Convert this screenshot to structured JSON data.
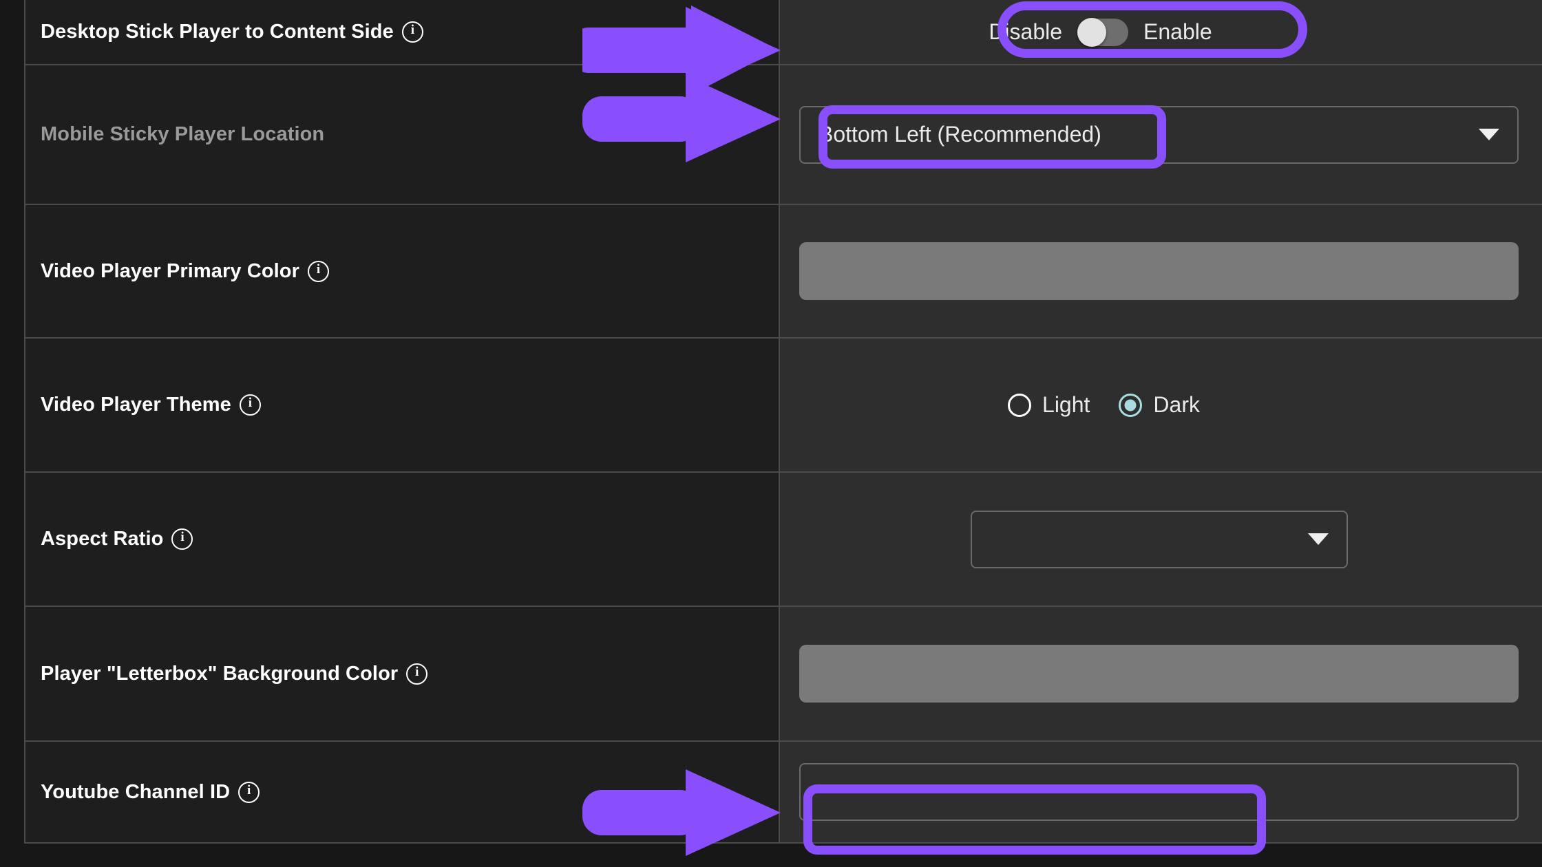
{
  "theme": {
    "page_bg": "#171717",
    "label_cell_bg": "#1e1e1e",
    "control_cell_bg": "#2e2e2e",
    "border": "#4b4b4b",
    "accent_annotation": "#8a4ffc",
    "swatch_gray": "#7a7a7a",
    "radio_checked": "#a8dbe0",
    "toggle_track": "#6e6e6e",
    "toggle_knob": "#e2e2e2"
  },
  "settings": {
    "rows": [
      {
        "id": "desktop-stick-player-to-content-side",
        "label": "Desktop Stick Player to Content Side",
        "label_muted": false,
        "info_icon": "info-circle-icon",
        "control": "toggle",
        "toggle": {
          "off_label": "Disable",
          "on_label": "Enable",
          "state": "off"
        }
      },
      {
        "id": "mobile-sticky-player-location",
        "label": "Mobile Sticky Player Location",
        "label_muted": true,
        "info_icon": null,
        "control": "select-wide",
        "select": {
          "value": "Bottom Left (Recommended)",
          "chevron_icon": "chevron-down-icon"
        }
      },
      {
        "id": "video-player-primary-color",
        "label": "Video Player Primary Color",
        "label_muted": false,
        "info_icon": "info-circle-icon",
        "control": "color-swatch",
        "swatch": {
          "color": "#7a7a7a"
        }
      },
      {
        "id": "video-player-theme",
        "label": "Video Player Theme",
        "label_muted": false,
        "info_icon": "info-circle-icon",
        "control": "radio",
        "radio": {
          "options": [
            {
              "label": "Light",
              "checked": false
            },
            {
              "label": "Dark",
              "checked": true
            }
          ]
        }
      },
      {
        "id": "aspect-ratio",
        "label": "Aspect Ratio",
        "label_muted": false,
        "info_icon": "info-circle-icon",
        "control": "select-mid",
        "select": {
          "value": "",
          "chevron_icon": "chevron-down-icon"
        }
      },
      {
        "id": "player-letterbox-background-color",
        "label": "Player \"Letterbox\" Background Color",
        "label_muted": false,
        "info_icon": "info-circle-icon",
        "control": "color-swatch",
        "swatch": {
          "color": "#7a7a7a"
        }
      },
      {
        "id": "youtube-channel-id",
        "label": "Youtube Channel ID",
        "label_muted": false,
        "info_icon": "info-circle-icon",
        "control": "text-input",
        "input": {
          "value": "",
          "placeholder": ""
        }
      }
    ]
  },
  "annotations": {
    "color": "#8a4ffc",
    "arrows": [
      {
        "target": "desktop-stick-player-to-content-side"
      },
      {
        "target": "mobile-sticky-player-location"
      },
      {
        "target": "youtube-channel-id"
      }
    ],
    "highlights": [
      {
        "target": "toggle-disable-enable",
        "shape": "pill"
      },
      {
        "target": "mobile-sticky-player-location-select-value",
        "shape": "rounded"
      },
      {
        "target": "youtube-channel-id-input",
        "shape": "rounded"
      }
    ]
  }
}
